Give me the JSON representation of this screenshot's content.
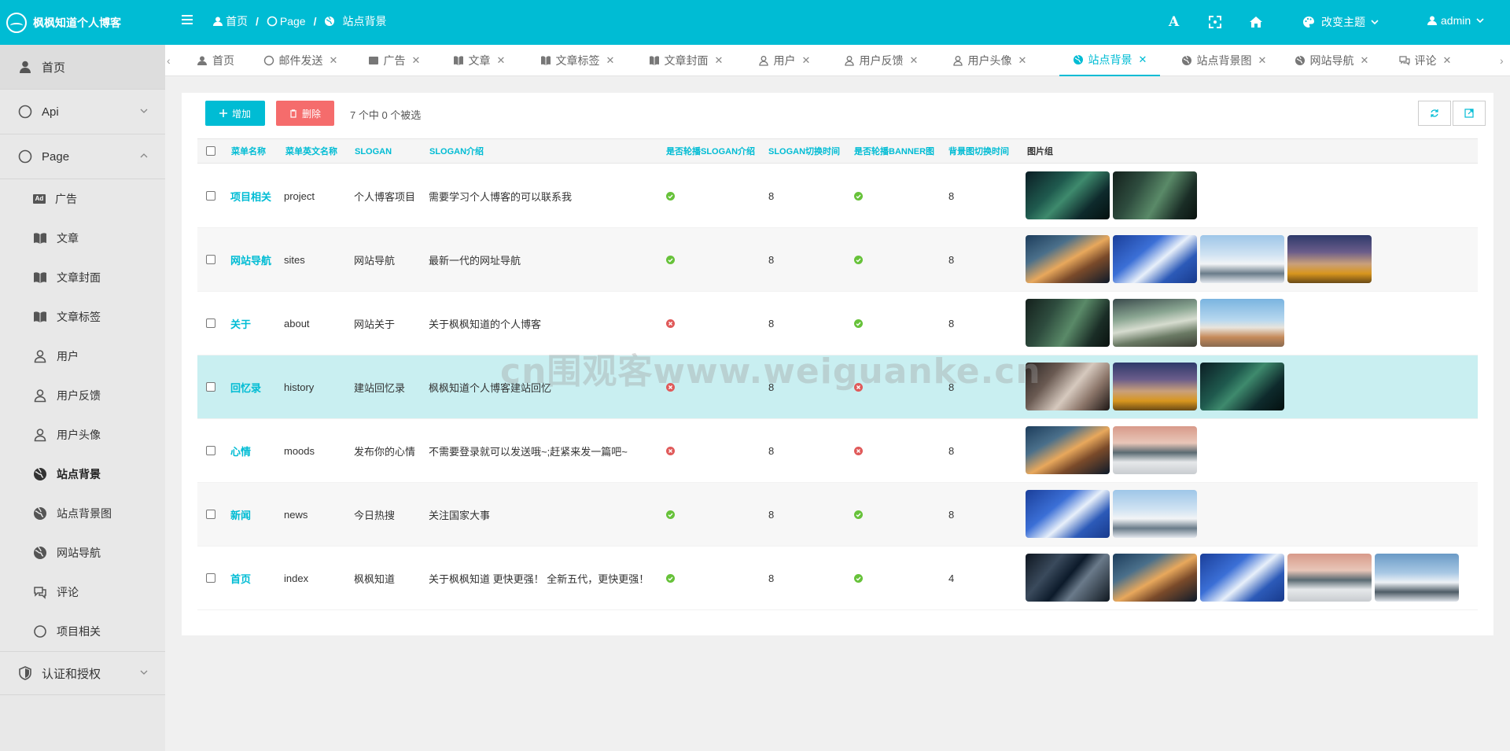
{
  "app": {
    "title": "枫枫知道个人博客"
  },
  "breadcrumb": {
    "home": "首页",
    "page": "Page",
    "current": "站点背景",
    "sep": "/"
  },
  "topbar": {
    "font_icon_label": "A",
    "theme_label": "改变主题",
    "user": "admin"
  },
  "sidebar": {
    "home": "首页",
    "api": "Api",
    "page": "Page",
    "page_items": [
      "广告",
      "文章",
      "文章封面",
      "文章标签",
      "用户",
      "用户反馈",
      "用户头像",
      "站点背景",
      "站点背景图",
      "网站导航",
      "评论",
      "项目相关"
    ],
    "auth": "认证和授权",
    "ad_badge": "Ad"
  },
  "tabs": [
    "首页",
    "邮件发送",
    "广告",
    "文章",
    "文章标签",
    "文章封面",
    "用户",
    "用户反馈",
    "用户头像",
    "站点背景",
    "站点背景图",
    "网站导航",
    "评论"
  ],
  "toolbar": {
    "add": "增加",
    "delete": "删除",
    "selection": "7 个中 0 个被选"
  },
  "table": {
    "columns": [
      "菜单名称",
      "菜单英文名称",
      "SLOGAN",
      "SLOGAN介绍",
      "是否轮播SLOGAN介绍",
      "SLOGAN切换时间",
      "是否轮播BANNER图",
      "背景图切换时间",
      "图片组"
    ],
    "rows": [
      {
        "name": "项目相关",
        "en": "project",
        "slogan": "个人博客项目",
        "intro": "需要学习个人博客的可以联系我",
        "slogan_loop": true,
        "slogan_time": "8",
        "banner_loop": true,
        "banner_time": "8"
      },
      {
        "name": "网站导航",
        "en": "sites",
        "slogan": "网站导航",
        "intro": "最新一代的网址导航",
        "slogan_loop": true,
        "slogan_time": "8",
        "banner_loop": true,
        "banner_time": "8"
      },
      {
        "name": "关于",
        "en": "about",
        "slogan": "网站关于",
        "intro": "关于枫枫知道的个人博客",
        "slogan_loop": false,
        "slogan_time": "8",
        "banner_loop": true,
        "banner_time": "8"
      },
      {
        "name": "回忆录",
        "en": "history",
        "slogan": "建站回忆录",
        "intro": "枫枫知道个人博客建站回忆",
        "slogan_loop": false,
        "slogan_time": "8",
        "banner_loop": false,
        "banner_time": "8"
      },
      {
        "name": "心情",
        "en": "moods",
        "slogan": "发布你的心情",
        "intro": "不需要登录就可以发送哦~;赶紧来发一篇吧~",
        "slogan_loop": false,
        "slogan_time": "8",
        "banner_loop": false,
        "banner_time": "8"
      },
      {
        "name": "新闻",
        "en": "news",
        "slogan": "今日热搜",
        "intro": "关注国家大事",
        "slogan_loop": true,
        "slogan_time": "8",
        "banner_loop": true,
        "banner_time": "8"
      },
      {
        "name": "首页",
        "en": "index",
        "slogan": "枫枫知道",
        "intro": "关于枫枫知道 更快更强！ 全新五代，更快更强！",
        "slogan_loop": true,
        "slogan_time": "8",
        "banner_loop": true,
        "banner_time": "4"
      }
    ]
  },
  "watermark": "cn围观客www.weiguanke.cn",
  "colors": {
    "accent": "#00bcd4",
    "danger": "#f56c6c",
    "ok": "#67c23a",
    "err": "#e05a5a",
    "highlight_row": "#c9eff1"
  }
}
